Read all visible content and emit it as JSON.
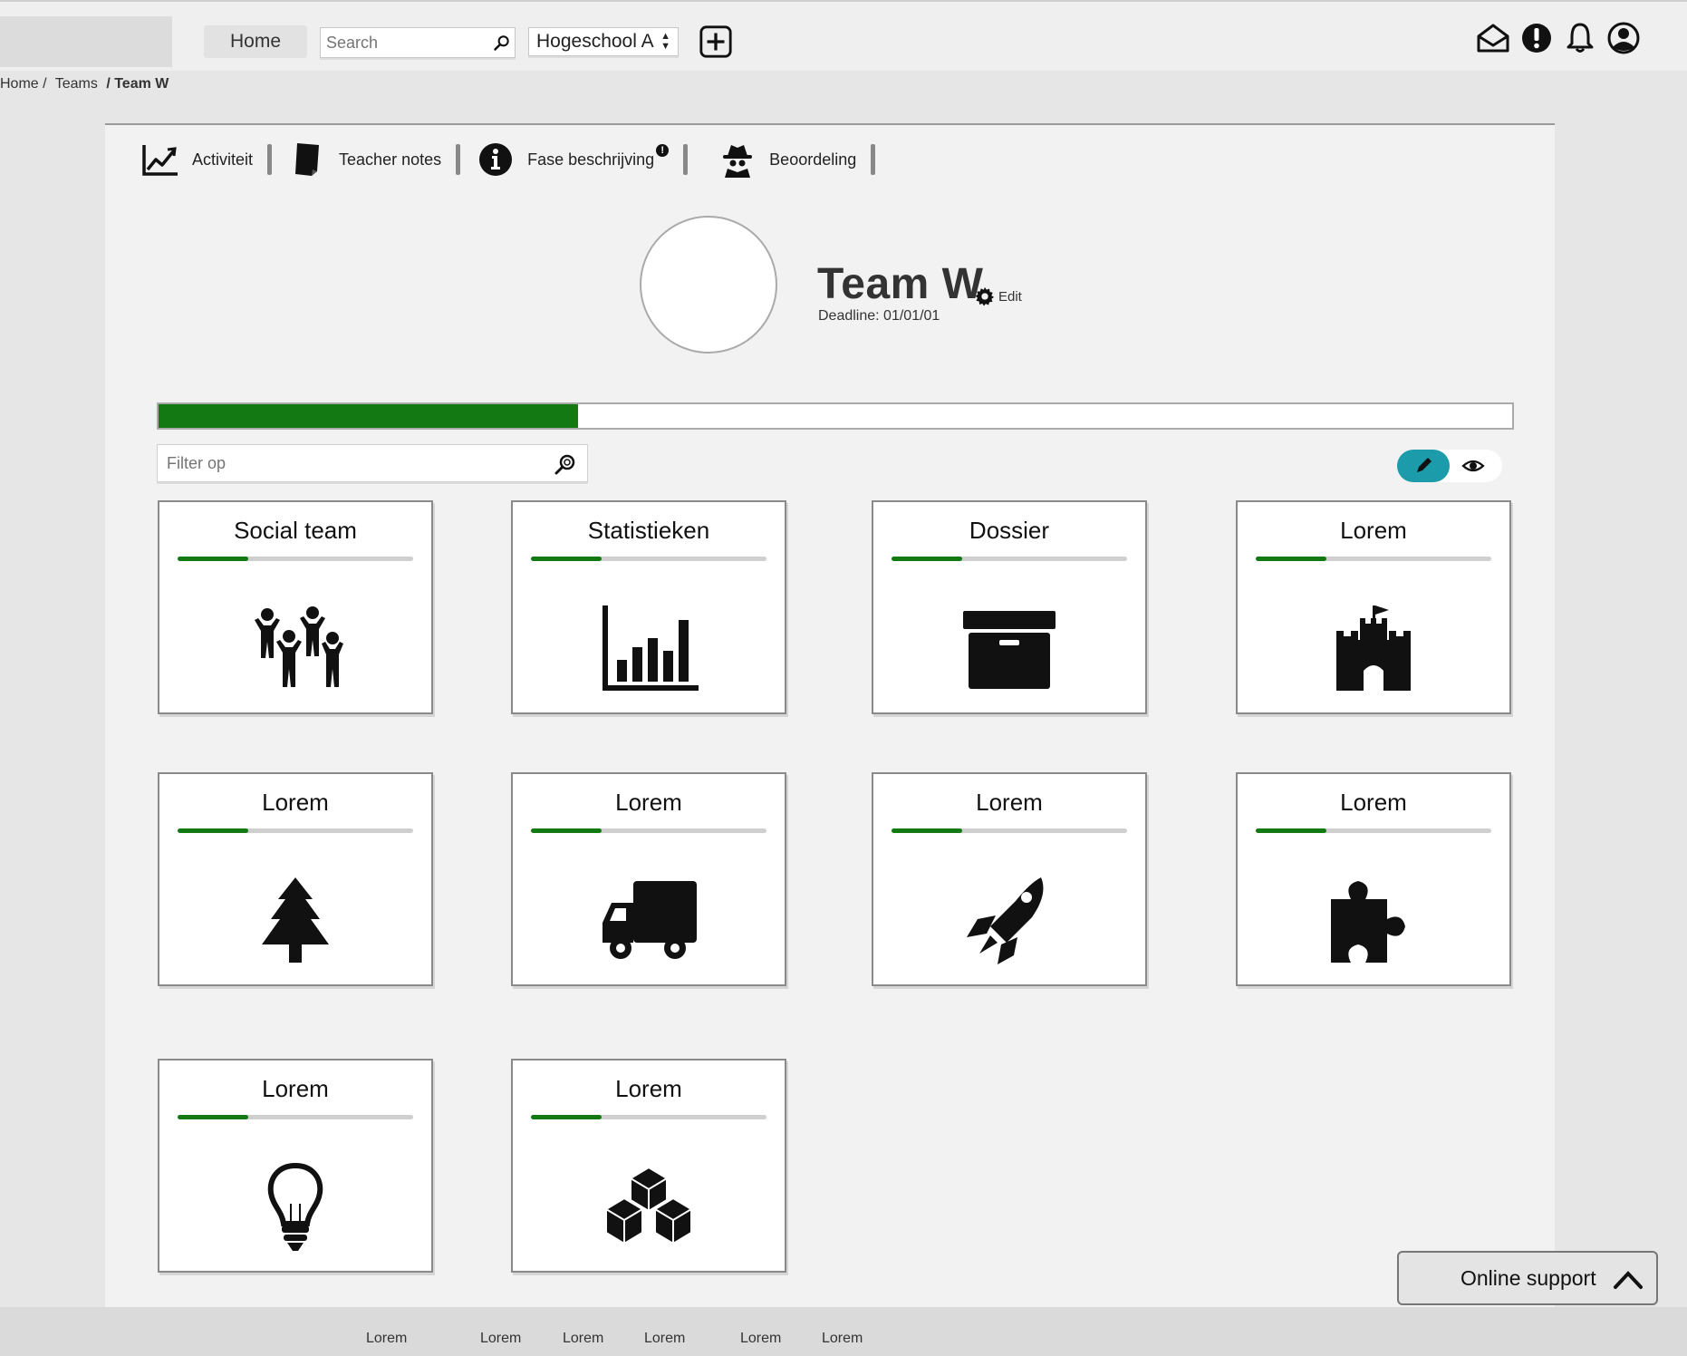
{
  "topbar": {
    "home_label": "Home",
    "search_placeholder": "Search",
    "school_value": "Hogeschool A",
    "icons": [
      "add-icon",
      "mail-icon",
      "alert-icon",
      "bell-icon",
      "user-icon"
    ]
  },
  "breadcrumb": [
    "Home /",
    "Teams",
    "/ Team W"
  ],
  "tabs": [
    {
      "label": "Activiteit",
      "icon": "chart-line-icon"
    },
    {
      "label": "Teacher notes",
      "icon": "notebook-icon"
    },
    {
      "label": "Fase beschrijving",
      "icon": "info-icon",
      "badge": "!"
    },
    {
      "label": "Beoordeling",
      "icon": "spy-icon"
    }
  ],
  "team": {
    "name": "Team W",
    "edit_label": "Edit",
    "deadline": "Deadline: 01/01/01",
    "progress": 0.31
  },
  "filter": {
    "placeholder": "Filter op"
  },
  "colors": {
    "progress": "#137a13",
    "accent": "#1c9bab"
  },
  "cards": [
    {
      "title": "Social team",
      "icon": "people-icon",
      "progress": 0.3
    },
    {
      "title": "Statistieken",
      "icon": "bar-chart-icon",
      "progress": 0.3
    },
    {
      "title": "Dossier",
      "icon": "archive-box-icon",
      "progress": 0.3
    },
    {
      "title": "Lorem",
      "icon": "castle-icon",
      "progress": 0.3
    },
    {
      "title": "Lorem",
      "icon": "tree-icon",
      "progress": 0.3
    },
    {
      "title": "Lorem",
      "icon": "truck-icon",
      "progress": 0.3
    },
    {
      "title": "Lorem",
      "icon": "rocket-icon",
      "progress": 0.3
    },
    {
      "title": "Lorem",
      "icon": "puzzle-icon",
      "progress": 0.3
    },
    {
      "title": "Lorem",
      "icon": "lightbulb-icon",
      "progress": 0.3
    },
    {
      "title": "Lorem",
      "icon": "cubes-icon",
      "progress": 0.3
    }
  ],
  "support": {
    "label": "Online support"
  },
  "footer": [
    "Lorem",
    "Lorem",
    "Lorem",
    "Lorem",
    "Lorem",
    "Lorem"
  ]
}
